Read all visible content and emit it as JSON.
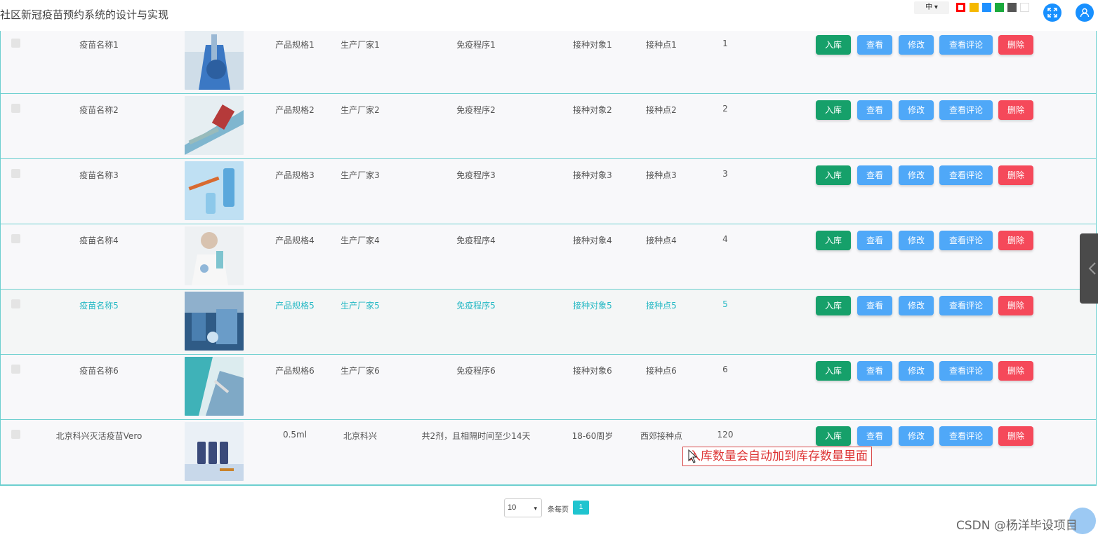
{
  "header": {
    "title": "社区新冠疫苗预约系统的设计与实现",
    "lang": "中",
    "lang_caret": "▾",
    "theme_colors": [
      "#ff0000",
      "#f5b800",
      "#1e90ff",
      "#1aaa3c",
      "#555555",
      "#ffffff"
    ],
    "fullscreen_icon": "fullscreen-icon",
    "user_icon": "user-icon"
  },
  "buttons": {
    "in": "入库",
    "view": "查看",
    "edit": "修改",
    "comments": "查看评论",
    "delete": "删除"
  },
  "rows": [
    {
      "name": "疫苗名称1",
      "spec": "产品规格1",
      "maker": "生产厂家1",
      "procedure": "免疫程序1",
      "target": "接种对象1",
      "site": "接种点1",
      "qty": "1"
    },
    {
      "name": "疫苗名称2",
      "spec": "产品规格2",
      "maker": "生产厂家2",
      "procedure": "免疫程序2",
      "target": "接种对象2",
      "site": "接种点2",
      "qty": "2"
    },
    {
      "name": "疫苗名称3",
      "spec": "产品规格3",
      "maker": "生产厂家3",
      "procedure": "免疫程序3",
      "target": "接种对象3",
      "site": "接种点3",
      "qty": "3"
    },
    {
      "name": "疫苗名称4",
      "spec": "产品规格4",
      "maker": "生产厂家4",
      "procedure": "免疫程序4",
      "target": "接种对象4",
      "site": "接种点4",
      "qty": "4"
    },
    {
      "name": "疫苗名称5",
      "spec": "产品规格5",
      "maker": "生产厂家5",
      "procedure": "免疫程序5",
      "target": "接种对象5",
      "site": "接种点5",
      "qty": "5"
    },
    {
      "name": "疫苗名称6",
      "spec": "产品规格6",
      "maker": "生产厂家6",
      "procedure": "免疫程序6",
      "target": "接种对象6",
      "site": "接种点6",
      "qty": "6"
    },
    {
      "name": "北京科兴灭活疫苗Vero",
      "spec": "0.5ml",
      "maker": "北京科兴",
      "procedure": "共2剂，且相隔时间至少14天",
      "target": "18-60周岁",
      "site": "西郊接种点",
      "qty": "120"
    }
  ],
  "annotation": "入库数量会自动加到库存数量里面",
  "pagination": {
    "page_size": "10",
    "page_size_caret": "▾",
    "per_page_label": "条每页",
    "current_page": "1"
  },
  "watermark": "CSDN @杨洋毕设项目"
}
